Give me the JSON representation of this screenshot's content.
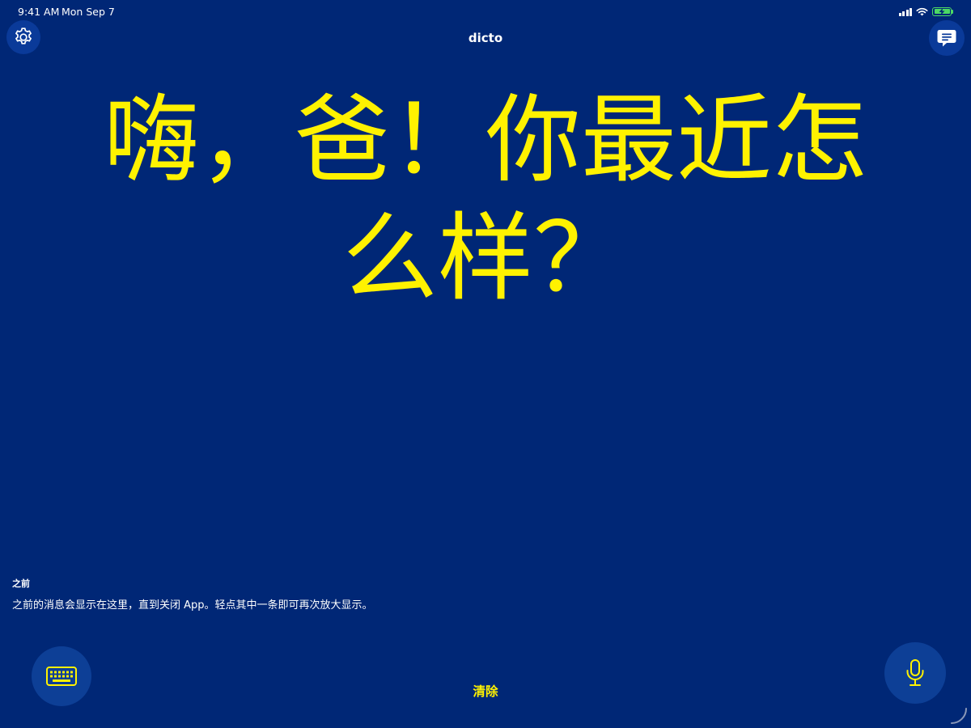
{
  "status_bar": {
    "time": "9:41 AM",
    "date": "Mon Sep 7"
  },
  "nav": {
    "title": "dicto",
    "settings_icon": "gear-icon",
    "history_icon": "speech-bubble-icon"
  },
  "main": {
    "message": "嗨，爸！你最近怎么样？"
  },
  "previous": {
    "heading": "之前",
    "hint": "之前的消息会显示在这里，直到关闭 App。轻点其中一条即可再次放大显示。"
  },
  "controls": {
    "keyboard_icon": "keyboard-icon",
    "clear_label": "清除",
    "mic_icon": "microphone-icon"
  },
  "colors": {
    "background": "#002776",
    "accent_yellow": "#fff200",
    "button_blue": "#0d3f96",
    "battery_green": "#4cd964"
  }
}
